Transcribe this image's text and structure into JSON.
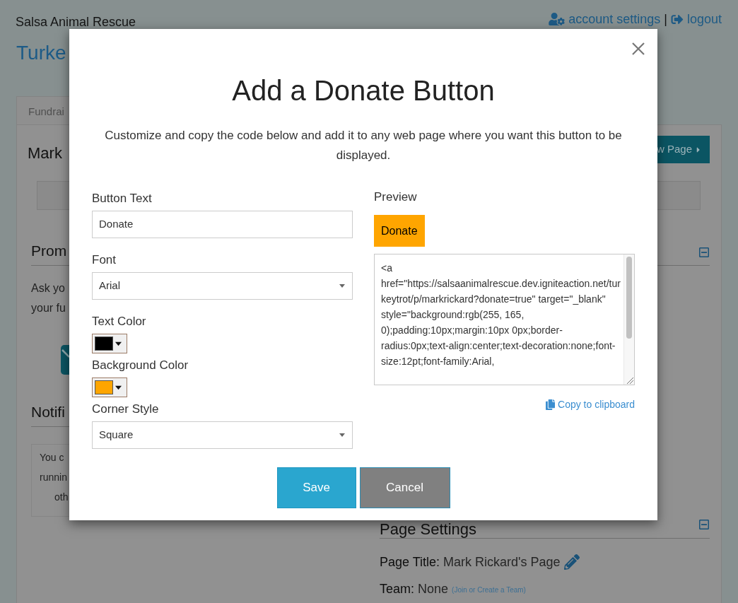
{
  "header": {
    "site_name": "Salsa Animal Rescue",
    "links": [
      {
        "kind": "account",
        "label": "account settings"
      },
      {
        "kind": "logout",
        "label": "logout"
      }
    ],
    "separator": "|"
  },
  "page_title": "Turke",
  "tab": {
    "label": "Fundrai"
  },
  "panel": {
    "heading": "Mark",
    "view_button": "w Page",
    "left_sections": [
      {
        "kind": "promo",
        "heading": "Prom",
        "lines": [
          "Ask yo",
          "your fu"
        ]
      },
      {
        "kind": "notice",
        "heading": "Notifi",
        "lines": [
          "You c",
          "runnin",
          "oth"
        ]
      }
    ],
    "page_settings": {
      "heading": "Page Settings",
      "rows": [
        {
          "kind": "editable",
          "label": "Page Title:",
          "value": "Mark Rickard's Page"
        },
        {
          "kind": "team",
          "label": "Team:",
          "value": "None",
          "link": "(Join or Create a Team)"
        }
      ]
    }
  },
  "modal": {
    "title": "Add a Donate Button",
    "description": "Customize and copy the code below and add it to any web page where you want this button to be displayed.",
    "fields": [
      {
        "kind": "text",
        "label": "Button Text",
        "value": "Donate"
      },
      {
        "kind": "select",
        "label": "Font",
        "value": "Arial"
      },
      {
        "kind": "color",
        "label": "Text Color",
        "color": "#000000"
      },
      {
        "kind": "color",
        "label": "Background Color",
        "color": "#ffa500"
      },
      {
        "kind": "select",
        "label": "Corner Style",
        "value": "Square"
      }
    ],
    "preview": {
      "label": "Preview",
      "button_text": "Donate"
    },
    "code": "<a href=\"https://salsaanimalrescue.dev.igniteaction.net/turkeytrot/p/markrickard?donate=true\" target=\"_blank\" style=\"background:rgb(255, 165, 0);padding:10px;margin:10px 0px;border-radius:0px;text-align:center;text-decoration:none;font-size:12pt;font-family:Arial,",
    "copy_link": "Copy to clipboard",
    "buttons": [
      {
        "kind": "primary",
        "label": "Save"
      },
      {
        "kind": "secondary",
        "label": "Cancel"
      }
    ]
  }
}
